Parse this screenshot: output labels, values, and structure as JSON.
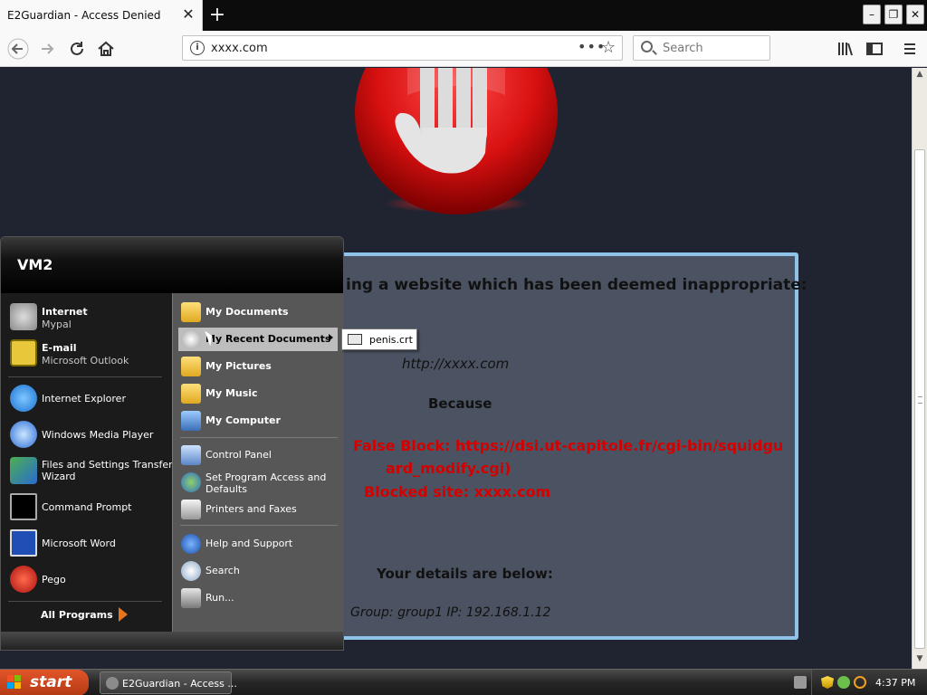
{
  "browser": {
    "tab_title": "E2Guardian - Access Denied",
    "tab_close": "✕",
    "new_tab": "+",
    "window_controls": {
      "minimize": "–",
      "restore": "❐",
      "close": "✕"
    },
    "nav_icons": [
      "back-icon",
      "forward-icon",
      "reload-icon",
      "home-icon"
    ],
    "url": "xxxx.com",
    "url_actions": {
      "more": "•••",
      "bookmark": "☆"
    },
    "search_placeholder": "Search",
    "toolbar_icons": [
      "library-icon",
      "sidebar-icon",
      "menu-icon"
    ]
  },
  "page": {
    "heading": "ing a website which has been deemed inappropriate:",
    "blocked_url": "http://xxxx.com",
    "because_label": "Because",
    "reason_line1": "False Block: https://dsi.ut-capitole.fr/cgi-bin/squidgu",
    "reason_line2": "ard_modify.cgi)",
    "reason_line3": "Blocked site: xxxx.com",
    "details_label": "Your details are below:",
    "group_ip": "Group: group1   IP: 192.168.1.12",
    "colors": {
      "background": "#1f2430",
      "box": "#4b5362",
      "box_border": "#8fc3ea",
      "reason_text": "#d40000"
    }
  },
  "start_menu": {
    "user": "VM2",
    "pinned": [
      {
        "title": "Internet",
        "subtitle": "Mypal",
        "icon": "raccoon-browser-icon"
      },
      {
        "title": "E-mail",
        "subtitle": "Microsoft Outlook",
        "icon": "outlook-icon"
      }
    ],
    "recent": [
      {
        "title": "Internet Explorer",
        "icon": "internet-explorer-icon"
      },
      {
        "title": "Windows Media Player",
        "icon": "media-player-icon"
      },
      {
        "title": "Files and Settings Transfer",
        "title2": "Wizard",
        "icon": "transfer-wizard-icon"
      },
      {
        "title": "Command Prompt",
        "icon": "command-prompt-icon"
      },
      {
        "title": "Microsoft Word",
        "icon": "word-icon"
      },
      {
        "title": "Pego",
        "icon": "pego-icon"
      }
    ],
    "all_programs": "All Programs",
    "right": {
      "my_documents": "My Documents",
      "my_recent_documents": "My Recent Documents",
      "my_pictures": "My Pictures",
      "my_music": "My Music",
      "my_computer": "My Computer",
      "control_panel": "Control Panel",
      "set_program_access_1": "Set Program Access and",
      "set_program_access_2": "Defaults",
      "printers_and_faxes": "Printers and Faxes",
      "help_and_support": "Help and Support",
      "search": "Search",
      "run": "Run..."
    },
    "submenu": {
      "file": "penis.crt"
    }
  },
  "taskbar": {
    "start": "start",
    "task_title": "E2Guardian - Access ...",
    "clock": "4:37 PM"
  }
}
